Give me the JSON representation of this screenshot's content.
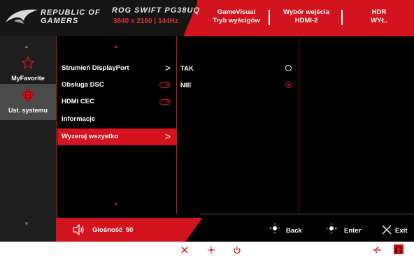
{
  "header": {
    "brand_line1": "REPUBLIC OF",
    "brand_line2": "GAMERS",
    "model": "ROG SWIFT PG38UQ",
    "resolution": "3840 x 2160 | 144Hz",
    "status": [
      {
        "line1": "GameVisual",
        "line2": "Tryb wyścigów"
      },
      {
        "line1": "Wybór wejścia",
        "line2": "HDMI-2"
      },
      {
        "line1": "HDR",
        "line2": "WYŁ."
      }
    ]
  },
  "nav": {
    "items": [
      {
        "label": "MyFavorite",
        "icon": "star-icon"
      },
      {
        "label": "Ust. systemu",
        "icon": "globe-icon",
        "active": true
      }
    ]
  },
  "menu": {
    "items": [
      {
        "label": "Strumień DisplayPort",
        "control": "chevron"
      },
      {
        "label": "Obsługa DSC",
        "control": "toggle"
      },
      {
        "label": "HDMI CEC",
        "control": "toggle"
      },
      {
        "label": "Informacje",
        "control": "none"
      },
      {
        "label": "Wyzeruj wszystko",
        "control": "chevron",
        "selected": true
      }
    ]
  },
  "options": {
    "items": [
      {
        "label": "TAK",
        "checked": false
      },
      {
        "label": "NIE",
        "checked": true
      }
    ]
  },
  "bottom": {
    "volume_label": "Głośność",
    "volume_value": "50",
    "back_label": "Back",
    "enter_label": "Enter",
    "exit_label": "Exit"
  },
  "colors": {
    "accent": "#d3131d",
    "background": "#000000",
    "sidebar": "#1e1e1e",
    "sidebar_active": "#4a4a4a"
  }
}
